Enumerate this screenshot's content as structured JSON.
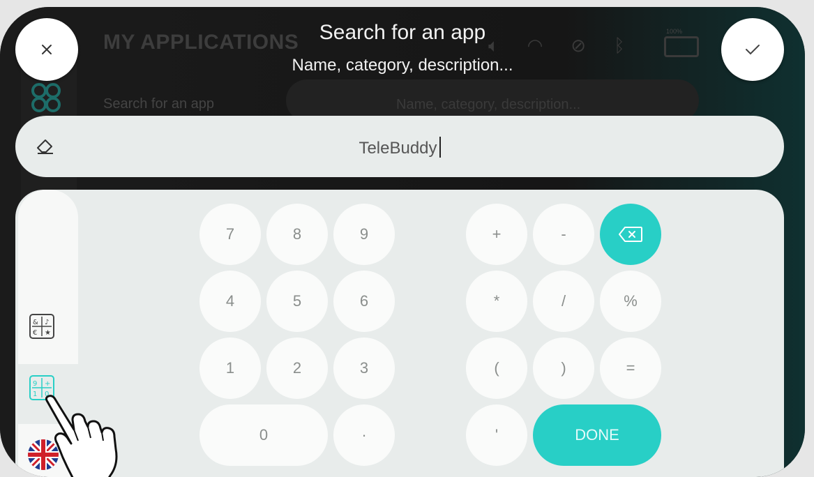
{
  "background": {
    "title": "MY APPLICATIONS",
    "search_label": "Search for an app",
    "search_placeholder": "Name, category, description...",
    "battery_label": "100%"
  },
  "header": {
    "title": "Search for an app",
    "subtitle": "Name, category, description..."
  },
  "search": {
    "value": "TeleBuddy"
  },
  "keypad": {
    "digits": [
      "7",
      "8",
      "9",
      "4",
      "5",
      "6",
      "1",
      "2",
      "3",
      "0",
      "·"
    ],
    "symbols": [
      "+",
      "-",
      "*",
      "/",
      "%",
      "(",
      ")",
      "=",
      "'"
    ],
    "done_label": "DONE"
  },
  "icons": {
    "close": "close-icon",
    "confirm": "checkmark-icon",
    "eraser": "eraser-icon",
    "backspace": "backspace-icon",
    "symbols_mode": "symbols-keyboard-icon",
    "numeric_mode": "numeric-keyboard-icon",
    "language": "uk-flag-icon"
  },
  "colors": {
    "accent": "#28cfc6",
    "panel": "#e8eceb",
    "key": "#fafbfa"
  }
}
